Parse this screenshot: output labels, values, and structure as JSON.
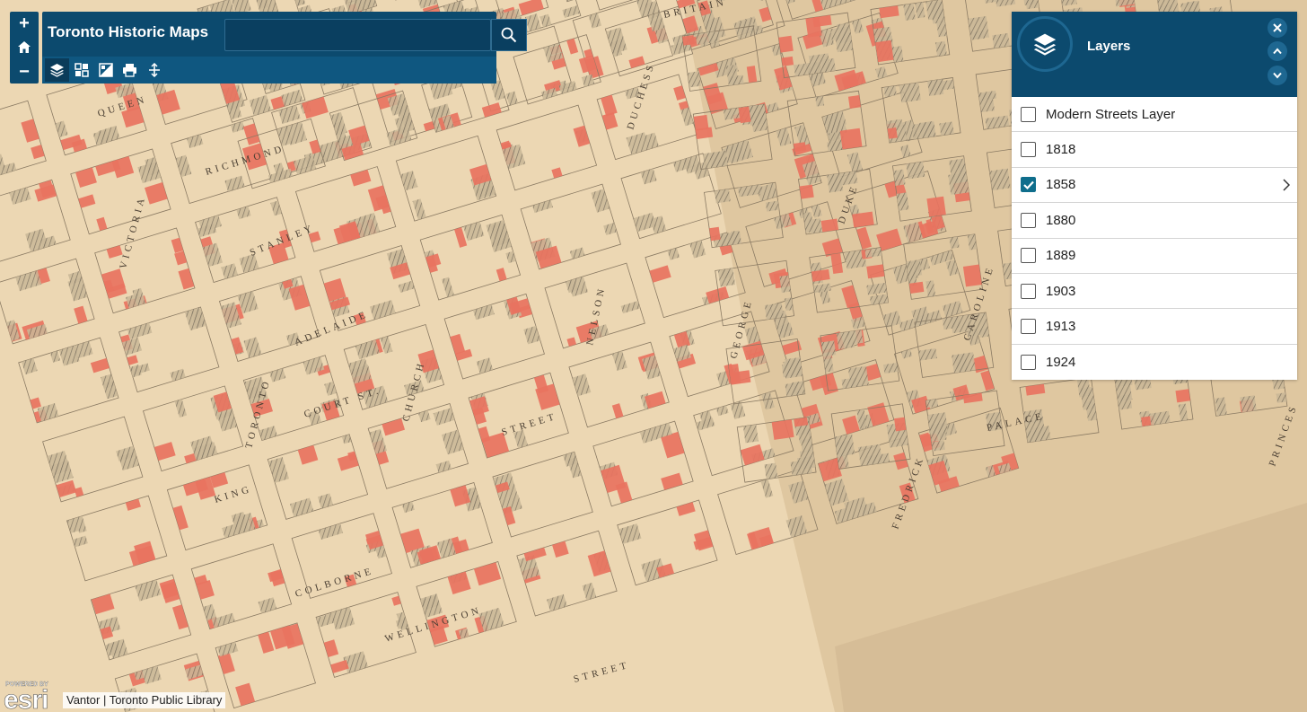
{
  "app": {
    "title": "Toronto Historic Maps",
    "search_placeholder": ""
  },
  "zoom": {
    "in_label": "+",
    "out_label": "−"
  },
  "toolbar": {
    "tools": [
      "layers-icon",
      "basemap-gallery-icon",
      "legend-icon",
      "print-icon",
      "measure-icon"
    ]
  },
  "layers_panel": {
    "title": "Layers",
    "items": [
      {
        "label": "Modern Streets Layer",
        "checked": false
      },
      {
        "label": "1818",
        "checked": false
      },
      {
        "label": "1858",
        "checked": true
      },
      {
        "label": "1880",
        "checked": false
      },
      {
        "label": "1889",
        "checked": false
      },
      {
        "label": "1903",
        "checked": false
      },
      {
        "label": "1913",
        "checked": false
      },
      {
        "label": "1924",
        "checked": false
      }
    ]
  },
  "attribution": {
    "powered_by": "POWERED BY",
    "logo_text": "esri",
    "text": "Vantor | Toronto Public Library"
  },
  "map": {
    "street_labels": [
      "QUEEN",
      "RICHMOND",
      "STANLEY",
      "ADELAIDE",
      "COURT ST.",
      "KING",
      "COLBORNE",
      "WELLINGTON",
      "STREET",
      "CHURCH",
      "DUCHESS",
      "DUKE",
      "NELSON",
      "STREET",
      "FREDRICK",
      "PALACE",
      "PRINCES",
      "VICTORIA",
      "TORONTO",
      "GEORGE",
      "BRITAIN",
      "CAROLINE"
    ],
    "colors": {
      "paper": "#ecd7b3",
      "building_red": "#e8735f",
      "building_gray": "#9a9080",
      "street": "#f3e6cc",
      "header": "#0c4a6e"
    }
  }
}
